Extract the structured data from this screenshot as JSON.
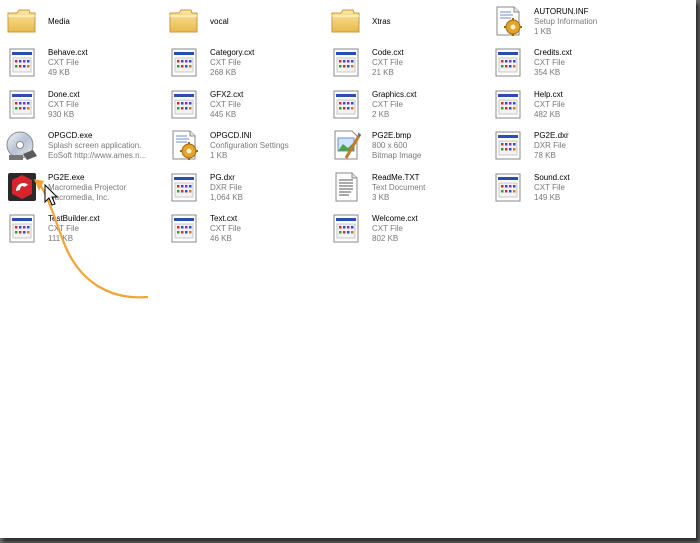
{
  "files": [
    {
      "id": "media",
      "type": "folder",
      "name": "Media",
      "line2": "",
      "line3": ""
    },
    {
      "id": "vocal",
      "type": "folder",
      "name": "vocal",
      "line2": "",
      "line3": ""
    },
    {
      "id": "xtras",
      "type": "folder",
      "name": "Xtras",
      "line2": "",
      "line3": ""
    },
    {
      "id": "autorun",
      "type": "inf",
      "name": "AUTORUN.INF",
      "line2": "Setup Information",
      "line3": "1 KB"
    },
    {
      "id": "behave",
      "type": "cxt",
      "name": "Behave.cxt",
      "line2": "CXT File",
      "line3": "49 KB"
    },
    {
      "id": "category",
      "type": "cxt",
      "name": "Category.cxt",
      "line2": "CXT File",
      "line3": "268 KB"
    },
    {
      "id": "code",
      "type": "cxt",
      "name": "Code.cxt",
      "line2": "CXT File",
      "line3": "21 KB"
    },
    {
      "id": "credits",
      "type": "cxt",
      "name": "Credits.cxt",
      "line2": "CXT File",
      "line3": "354 KB"
    },
    {
      "id": "done",
      "type": "cxt",
      "name": "Done.cxt",
      "line2": "CXT File",
      "line3": "930 KB"
    },
    {
      "id": "gfx2",
      "type": "cxt",
      "name": "GFX2.cxt",
      "line2": "CXT File",
      "line3": "445 KB"
    },
    {
      "id": "graphics",
      "type": "cxt",
      "name": "Graphics.cxt",
      "line2": "CXT File",
      "line3": "2 KB"
    },
    {
      "id": "help",
      "type": "cxt",
      "name": "Help.cxt",
      "line2": "CXT File",
      "line3": "482 KB"
    },
    {
      "id": "opgcd-exe",
      "type": "cd",
      "name": "OPGCD.exe",
      "line2": "Splash screen application.",
      "line3": "EoSoft     http://www.ames.n..."
    },
    {
      "id": "opgcd-ini",
      "type": "inf",
      "name": "OPGCD.INI",
      "line2": "Configuration Settings",
      "line3": "1 KB"
    },
    {
      "id": "pg2e-bmp",
      "type": "bmp",
      "name": "PG2E.bmp",
      "line2": "800 x 600",
      "line3": "Bitmap Image"
    },
    {
      "id": "pg2e-dxr",
      "type": "cxt",
      "name": "PG2E.dxr",
      "line2": "DXR File",
      "line3": "78 KB"
    },
    {
      "id": "pg2e-exe",
      "type": "projector",
      "name": "PG2E.exe",
      "line2": "Macromedia Projector",
      "line3": "Macromedia, Inc."
    },
    {
      "id": "pg-dxr",
      "type": "cxt",
      "name": "PG.dxr",
      "line2": "DXR File",
      "line3": "1,064 KB"
    },
    {
      "id": "readme",
      "type": "txt",
      "name": "ReadMe.TXT",
      "line2": "Text Document",
      "line3": "3 KB"
    },
    {
      "id": "sound",
      "type": "cxt",
      "name": "Sound.cxt",
      "line2": "CXT File",
      "line3": "149 KB"
    },
    {
      "id": "testbuilder",
      "type": "cxt",
      "name": "TestBuilder.cxt",
      "line2": "CXT File",
      "line3": "111 KB"
    },
    {
      "id": "text",
      "type": "cxt",
      "name": "Text.cxt",
      "line2": "CXT File",
      "line3": "46 KB"
    },
    {
      "id": "welcome",
      "type": "cxt",
      "name": "Welcome.cxt",
      "line2": "CXT File",
      "line3": "802 KB"
    }
  ],
  "colors": {
    "annotation_arrow": "#f2a336",
    "folder_yellow": "#f6d67a",
    "subtext_gray": "#7a7a7a"
  }
}
